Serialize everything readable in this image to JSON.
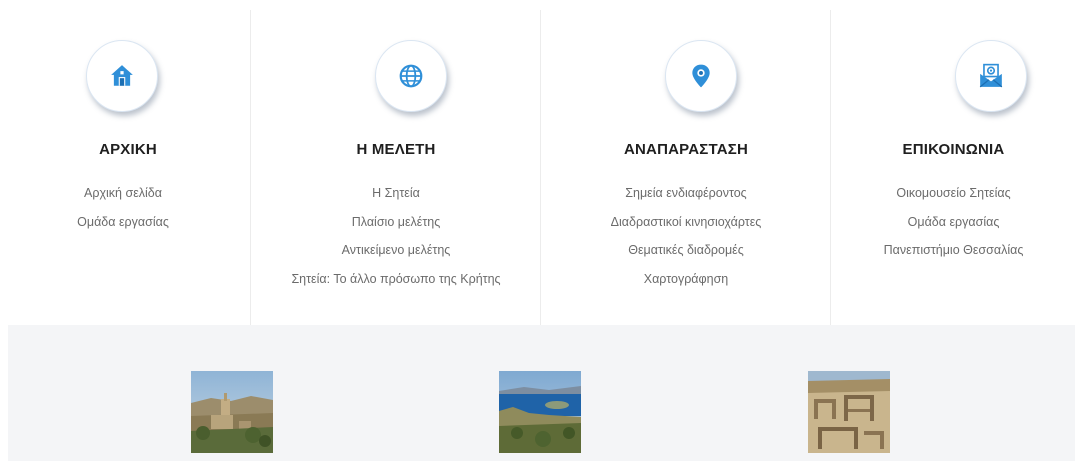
{
  "columns": [
    {
      "title": "ΑΡΧΙΚΗ",
      "icon": "home-icon",
      "links": [
        "Αρχική σελίδα",
        "Ομάδα εργασίας"
      ]
    },
    {
      "title": "Η ΜΕΛΕΤΗ",
      "icon": "globe-icon",
      "links": [
        "Η Σητεία",
        "Πλαίσιο μελέτης",
        "Αντικείμενο μελέτης",
        "Σητεία: Το άλλο πρόσωπο της Κρήτης"
      ]
    },
    {
      "title": "ΑΝΑΠΑΡΑΣΤΑΣΗ",
      "icon": "map-pin-icon",
      "links": [
        "Σημεία ενδιαφέροντος",
        "Διαδραστικοί κινησιοχάρτες",
        "Θεματικές διαδρομές",
        "Χαρτογράφηση"
      ]
    },
    {
      "title": "ΕΠΙΚΟΙΝΩΝΙΑ",
      "icon": "email-icon",
      "links": [
        "Οικομουσείο Σητείας",
        "Ομάδα εργασίας",
        "Πανεπιστήμιο Θεσσαλίας"
      ]
    }
  ],
  "colors": {
    "icon_blue": "#2f8fd8",
    "title": "#1f1f1f",
    "link": "#6b6b6b",
    "bottom_band": "#f4f5f7"
  },
  "thumbnails": [
    {
      "icon": "village-photo"
    },
    {
      "icon": "coast-photo"
    },
    {
      "icon": "ruins-photo"
    }
  ]
}
